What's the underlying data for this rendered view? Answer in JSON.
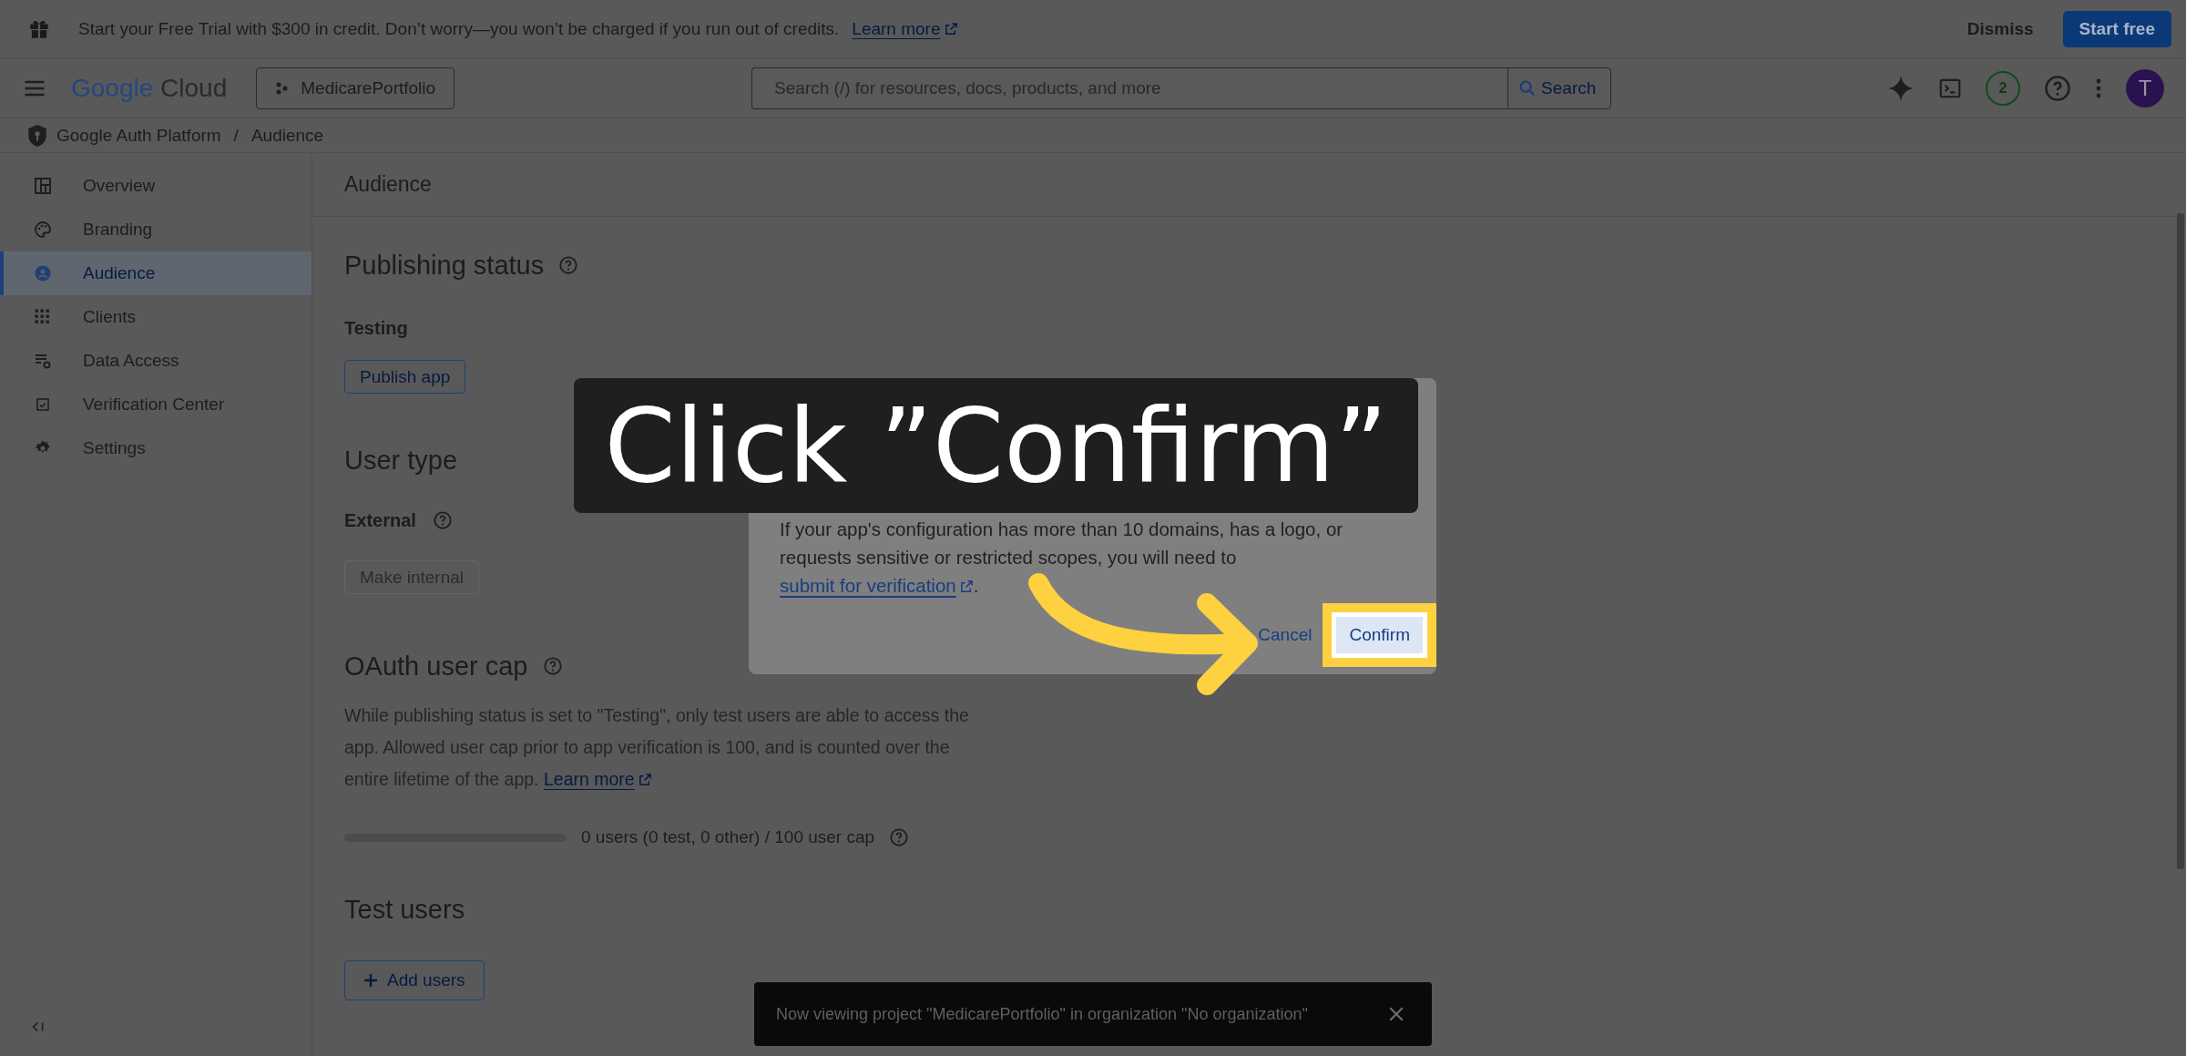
{
  "promo_bar": {
    "text": "Start your Free Trial with $300 in credit. Don’t worry—you won’t be charged if you run out of credits.",
    "link": "Learn more",
    "dismiss": "Dismiss",
    "start": "Start free"
  },
  "header": {
    "logo_google": "Google",
    "logo_cloud": "Cloud",
    "project": "MedicarePortfolio",
    "search_placeholder": "Search (/) for resources, docs, products, and more",
    "search_button": "Search",
    "notification_count": "2",
    "avatar": "T"
  },
  "breadcrumb": {
    "items": [
      "Google Auth Platform",
      "Audience"
    ],
    "separator": "/"
  },
  "sidebar": {
    "items": [
      {
        "label": "Overview",
        "kind": "dashboard",
        "selected": false
      },
      {
        "label": "Branding",
        "kind": "palette",
        "selected": false
      },
      {
        "label": "Audience",
        "kind": "person",
        "selected": true
      },
      {
        "label": "Clients",
        "kind": "grid",
        "selected": false
      },
      {
        "label": "Data Access",
        "kind": "data",
        "selected": false
      },
      {
        "label": "Verification Center",
        "kind": "calendar",
        "selected": false
      },
      {
        "label": "Settings",
        "kind": "gear",
        "selected": false
      }
    ]
  },
  "page": {
    "title": "Audience",
    "publishing": {
      "heading": "Publishing status",
      "status": "Testing",
      "button": "Publish app"
    },
    "user_type": {
      "heading": "User type",
      "value": "External",
      "button": "Make internal",
      "button_disabled": true
    },
    "user_cap": {
      "heading": "OAuth user cap",
      "text": "While publishing status is set to \"Testing\", only test users are able to access the app. Allowed user cap prior to app verification is 100, and is counted over the entire lifetime of the app.",
      "link": "Learn more",
      "level": 0,
      "reading": "0 users (0 test, 0 other) / 100 user cap"
    },
    "test_users": {
      "heading": "Test users",
      "button": "Add users"
    }
  },
  "dialog": {
    "text": "If your app's configuration has more than 10 domains, has a logo, or requests sensitive or restricted scopes, you will need to",
    "link": "submit for verification",
    "end": ".",
    "buttons": [
      {
        "label": "Cancel",
        "highlighted": false
      },
      {
        "label": "Confirm",
        "highlighted": true
      }
    ]
  },
  "callout": {
    "text": "Click ”Confirm”"
  },
  "toast": {
    "text": "Now viewing project \"MedicarePortfolio\" in organization \"No organization\""
  }
}
